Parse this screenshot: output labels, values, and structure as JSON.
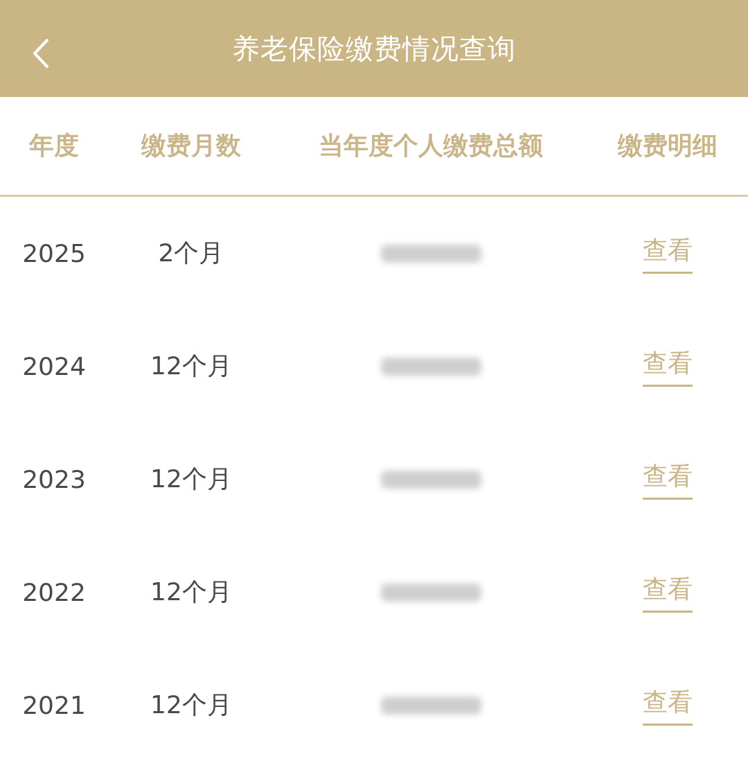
{
  "header": {
    "title": "养老保险缴费情况查询"
  },
  "table": {
    "columns": [
      "年度",
      "缴费月数",
      "当年度个人缴费总额",
      "缴费明细"
    ],
    "rows": [
      {
        "year": "2025",
        "months": "2个月",
        "detail": "查看"
      },
      {
        "year": "2024",
        "months": "12个月",
        "detail": "查看"
      },
      {
        "year": "2023",
        "months": "12个月",
        "detail": "查看"
      },
      {
        "year": "2022",
        "months": "12个月",
        "detail": "查看"
      },
      {
        "year": "2021",
        "months": "12个月",
        "detail": "查看"
      }
    ]
  }
}
